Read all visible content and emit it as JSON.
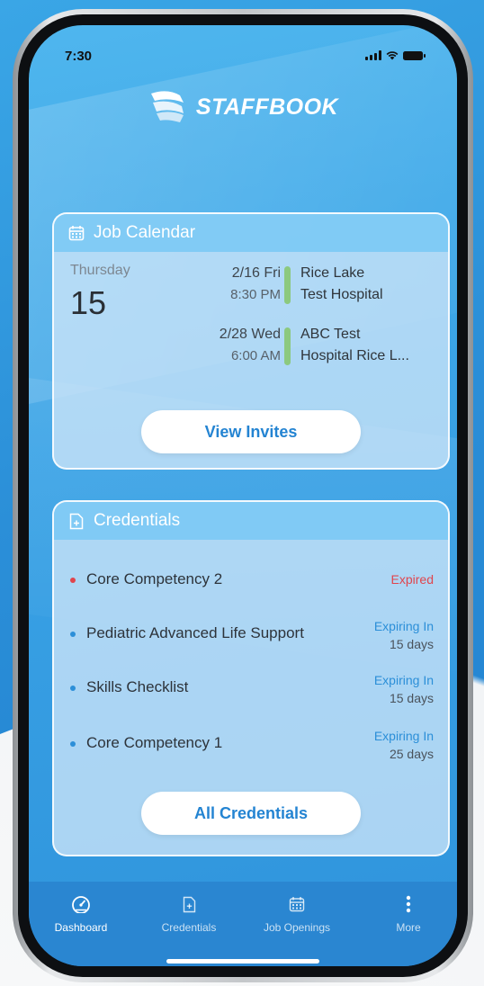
{
  "status_bar": {
    "time": "7:30"
  },
  "brand": {
    "name": "STAFFBOOK",
    "logo_icon": "staffbook-logo-icon"
  },
  "job_calendar": {
    "title": "Job Calendar",
    "icon": "calendar-icon",
    "weekday": "Thursday",
    "day": "15",
    "events": [
      {
        "date": "2/16 Fri",
        "time": "8:30 PM",
        "line1": "Rice Lake",
        "line2": "Test Hospital"
      },
      {
        "date": "2/28 Wed",
        "time": "6:00 AM",
        "line1": "ABC Test",
        "line2": "Hospital Rice L..."
      }
    ],
    "button_label": "View Invites",
    "event_bar_color": "#8cc97f"
  },
  "credentials": {
    "title": "Credentials",
    "icon": "document-plus-icon",
    "items": [
      {
        "name": "Core Competency 2",
        "status": "Expired",
        "detail": "",
        "dot_color": "#e0454d"
      },
      {
        "name": "Pediatric Advanced Life Support",
        "status": "Expiring In",
        "detail": "15 days",
        "dot_color": "#2c8fd8"
      },
      {
        "name": "Skills Checklist",
        "status": "Expiring In",
        "detail": "15 days",
        "dot_color": "#2c8fd8"
      },
      {
        "name": "Core Competency 1",
        "status": "Expiring In",
        "detail": "25 days",
        "dot_color": "#2c8fd8"
      }
    ],
    "button_label": "All Credentials"
  },
  "tab_bar": {
    "tabs": [
      {
        "label": "Dashboard",
        "icon": "dashboard-gauge-icon",
        "active": true
      },
      {
        "label": "Credentials",
        "icon": "document-plus-icon",
        "active": false
      },
      {
        "label": "Job Openings",
        "icon": "calendar-icon",
        "active": false
      },
      {
        "label": "More",
        "icon": "more-vertical-icon",
        "active": false
      }
    ]
  },
  "colors": {
    "accent": "#2484d2",
    "expired": "#e0454d",
    "tab_bar": "#2a86d1"
  }
}
